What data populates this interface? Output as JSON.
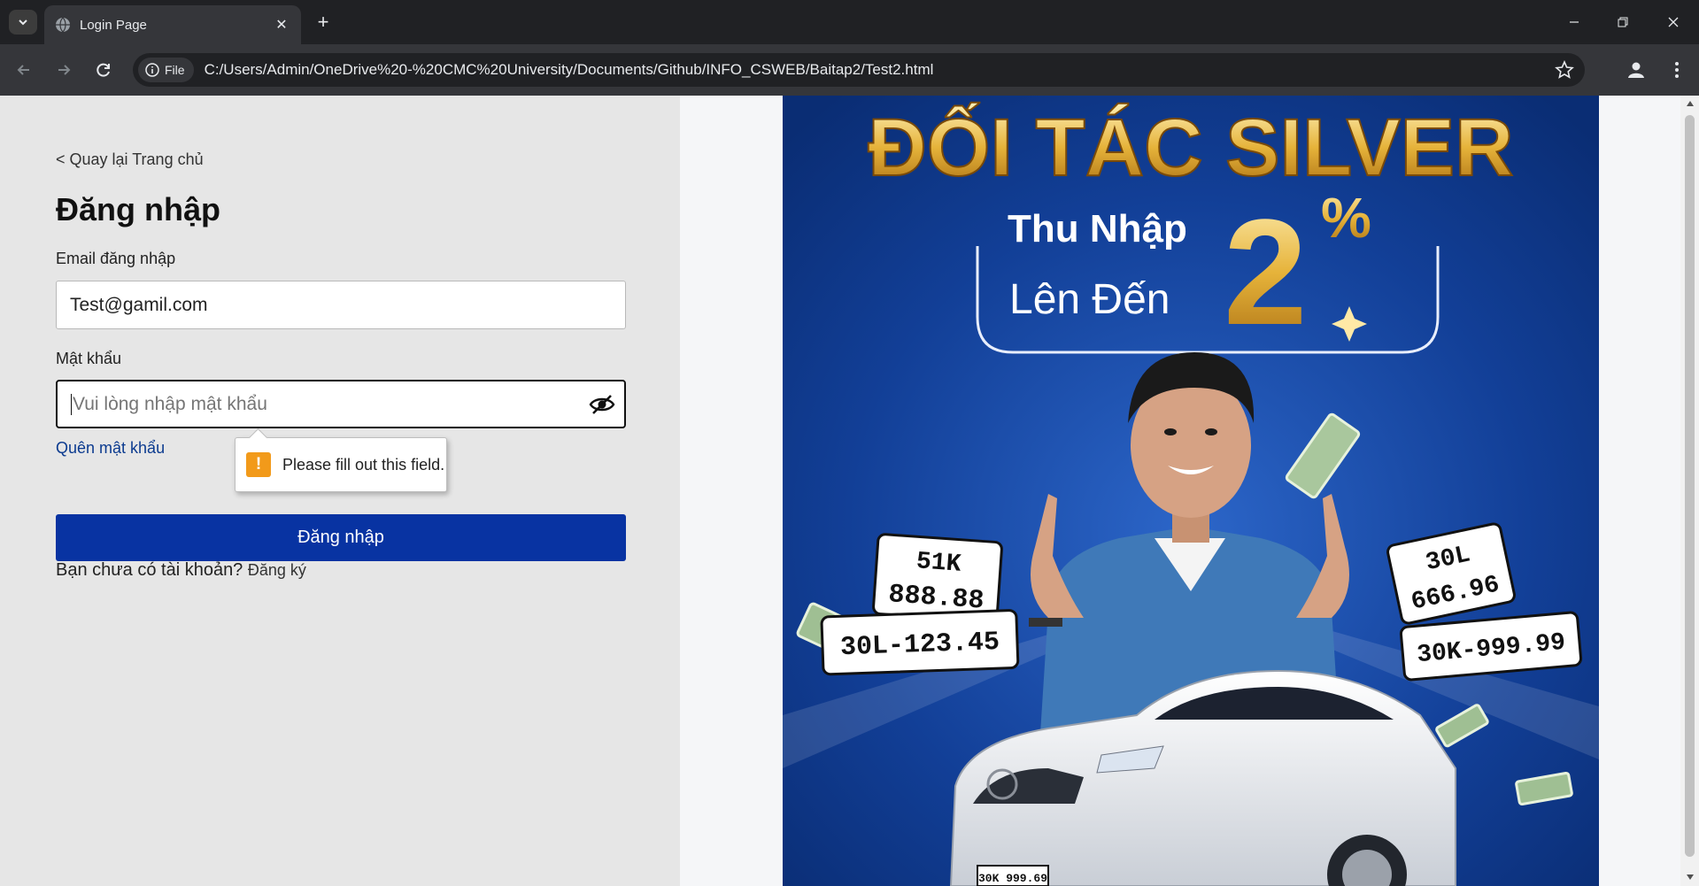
{
  "browser": {
    "tab_title": "Login Page",
    "file_chip": "File",
    "url": "C:/Users/Admin/OneDrive%20-%20CMC%20University/Documents/Github/INFO_CSWEB/Baitap2/Test2.html"
  },
  "login": {
    "back_link": "< Quay lại Trang chủ",
    "title": "Đăng nhập",
    "email_label": "Email đăng nhập",
    "email_value": "Test@gamil.com",
    "password_label": "Mật khẩu",
    "password_placeholder": "Vui lòng nhập mật khẩu",
    "forgot_link": "Quên mật khẩu",
    "validation_tooltip": "Please fill out this field.",
    "submit_label": "Đăng nhập",
    "no_account_text": "Bạn chưa có tài khoản?",
    "signup_link": "Đăng ký"
  },
  "banner": {
    "headline": "ĐỐI TÁC SILVER",
    "income_line1": "Thu Nhập",
    "income_line2": "Lên Đến",
    "percent_value": "2",
    "percent_sign": "%",
    "plates": [
      "51K",
      "888.88",
      "30L-123.45",
      "30L",
      "666.96",
      "30K-999.99",
      "30K 999.69"
    ],
    "colors": {
      "background": "#0c3a8e",
      "gold": "#e6b33a",
      "accent": "#0833a2"
    }
  },
  "icons": [
    "chevron-down-icon",
    "globe-icon",
    "close-icon",
    "plus-icon",
    "minimize-icon",
    "restore-icon",
    "back-icon",
    "forward-icon",
    "reload-icon",
    "info-icon",
    "star-icon",
    "profile-icon",
    "more-vert-icon",
    "eye-off-icon",
    "warning-icon"
  ]
}
